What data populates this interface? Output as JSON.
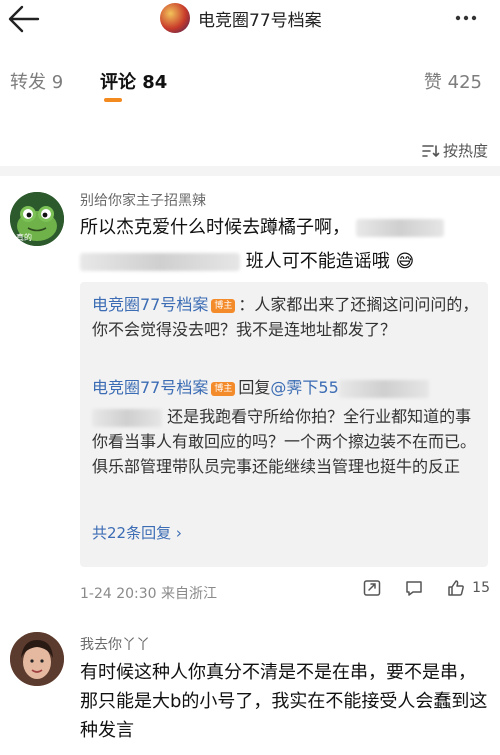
{
  "header": {
    "title": "电竞圈77号档案"
  },
  "tabs": {
    "repost_label": "转发",
    "repost_count": "9",
    "comment_label": "评论",
    "comment_count": "84",
    "like_label": "赞",
    "like_count": "425",
    "active": "comment"
  },
  "sort": {
    "label": "按热度"
  },
  "comments": [
    {
      "username": "别给你家主子招黑辣",
      "avatar_text": "真的",
      "text_line1": "所以杰克爱什么时候去蹲橘子啊，",
      "text_line2_tail": "班人可不能造谣哦",
      "replies": [
        {
          "name": "电竞圈77号档案",
          "badge": "博主",
          "text": "：人家都出来了还搁这问问问的，你不会觉得没去吧？我不是连地址都发了？"
        },
        {
          "name": "电竞圈77号档案",
          "badge": "博主",
          "reply_word": "回复",
          "reply_to": "@霁下55",
          "text": "还是我跑看守所给你拍？全行业都知道的事你看当事人有敢回应的吗？一个两个擦边装不在而已。俱乐部管理带队员完事还能继续当管理也挺牛的反正"
        }
      ],
      "more_replies": "共22条回复 ›",
      "time": "1-24 20:30",
      "location": "来自浙江",
      "like_count": "15"
    },
    {
      "username": "我去你丫丫",
      "text": "有时候这种人你真分不清是不是在串，要不是串，那只能是大b的小号了，我实在不能接受人会蠢到这种发言"
    }
  ],
  "colors": {
    "accent_orange": "#f28a1f",
    "link_blue": "#3b6cb4",
    "badge_orange": "#f48b2b"
  }
}
